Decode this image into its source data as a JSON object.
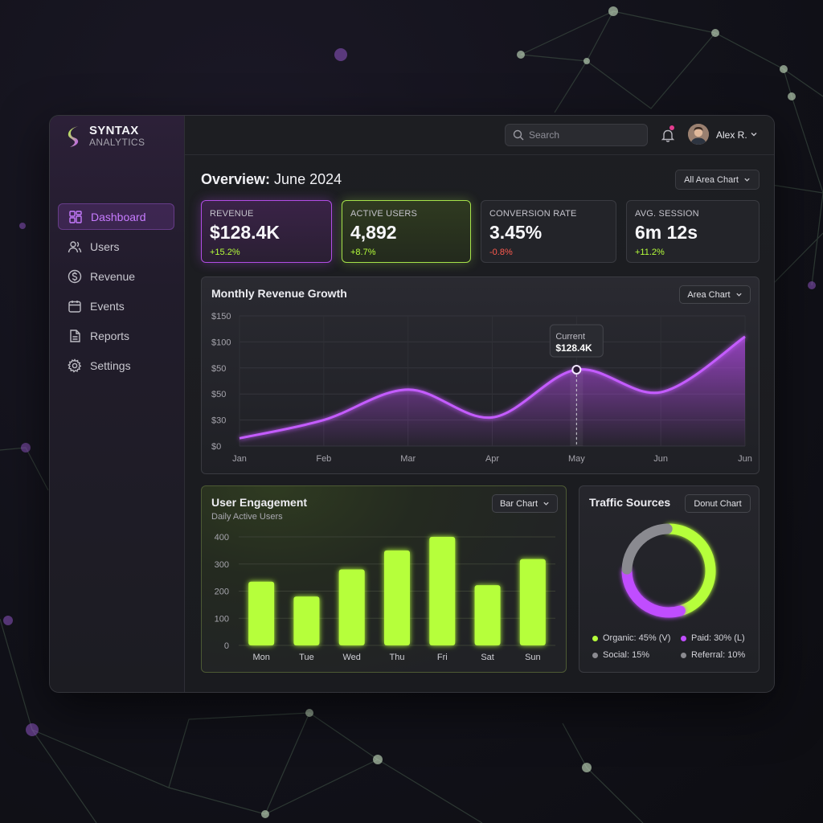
{
  "brand": {
    "name": "SYNTAX",
    "sub": "ANALYTICS"
  },
  "sidebar": {
    "items": [
      {
        "label": "Dashboard",
        "icon": "dashboard-grid-icon",
        "active": true
      },
      {
        "label": "Users",
        "icon": "users-icon"
      },
      {
        "label": "Revenue",
        "icon": "dollar-circle-icon"
      },
      {
        "label": "Events",
        "icon": "calendar-icon"
      },
      {
        "label": "Reports",
        "icon": "document-icon"
      },
      {
        "label": "Settings",
        "icon": "gear-icon"
      }
    ]
  },
  "topbar": {
    "search_placeholder": "Search",
    "user_name": "Alex R.",
    "notification": true
  },
  "page": {
    "title_bold": "Overview:",
    "title_rest": " June 2024",
    "filter_label": "All Area Chart"
  },
  "kpis": [
    {
      "label": "REVENUE",
      "value": "$128.4K",
      "delta": "+15.2%",
      "trend": "up"
    },
    {
      "label": "ACTIVE USERS",
      "value": "4,892",
      "delta": "+8.7%",
      "trend": "up"
    },
    {
      "label": "CONVERSION RATE",
      "value": "3.45%",
      "delta": "-0.8%",
      "trend": "down"
    },
    {
      "label": "AVG. SESSION",
      "value": "6m 12s",
      "delta": "+11.2%",
      "trend": "up"
    }
  ],
  "colors": {
    "purple": "#c04dff",
    "lime": "#b6ff3b",
    "gray": "#8a8a90",
    "down": "#ff5a4e",
    "up": "#b6ff3b"
  },
  "chart_data": [
    {
      "type": "area",
      "title": "Monthly Revenue Growth",
      "button_label": "Area Chart",
      "x": [
        "Jan",
        "Feb",
        "Mar",
        "Apr",
        "May",
        "Jun",
        "Jun"
      ],
      "y_ticks": [
        "$150",
        "$100",
        "$50",
        "$50",
        "$30",
        "$0"
      ],
      "series": [
        {
          "values": [
            9,
            30,
            65,
            33,
            88,
            62,
            126
          ]
        }
      ],
      "ylim": [
        0,
        150
      ],
      "tooltip": {
        "label": "Current",
        "value": "$128.4K",
        "index": 4
      },
      "grid": true
    },
    {
      "type": "bar",
      "title": "User Engagement",
      "subtitle": "Daily Active Users",
      "button_label": "Bar Chart",
      "categories": [
        "Mon",
        "Tue",
        "Wed",
        "Thu",
        "Fri",
        "Sat",
        "Sun"
      ],
      "values": [
        235,
        180,
        280,
        350,
        400,
        222,
        318
      ],
      "y_ticks": [
        "400",
        "300",
        "200",
        "100",
        "0"
      ],
      "ylim": [
        0,
        400
      ],
      "grid": true
    },
    {
      "type": "pie",
      "title": "Traffic Sources",
      "button_label": "Donut Chart",
      "series": [
        {
          "name": "Organic: 45% (V)",
          "value": 45,
          "color": "#b6ff3b"
        },
        {
          "name": "Paid: 30% (L)",
          "value": 30,
          "color": "#c04dff"
        },
        {
          "name": "Social: 15%",
          "value": 15,
          "color": "#8a8a90"
        },
        {
          "name": "Referral: 10%",
          "value": 10,
          "color": "#8a8a90"
        }
      ]
    }
  ]
}
